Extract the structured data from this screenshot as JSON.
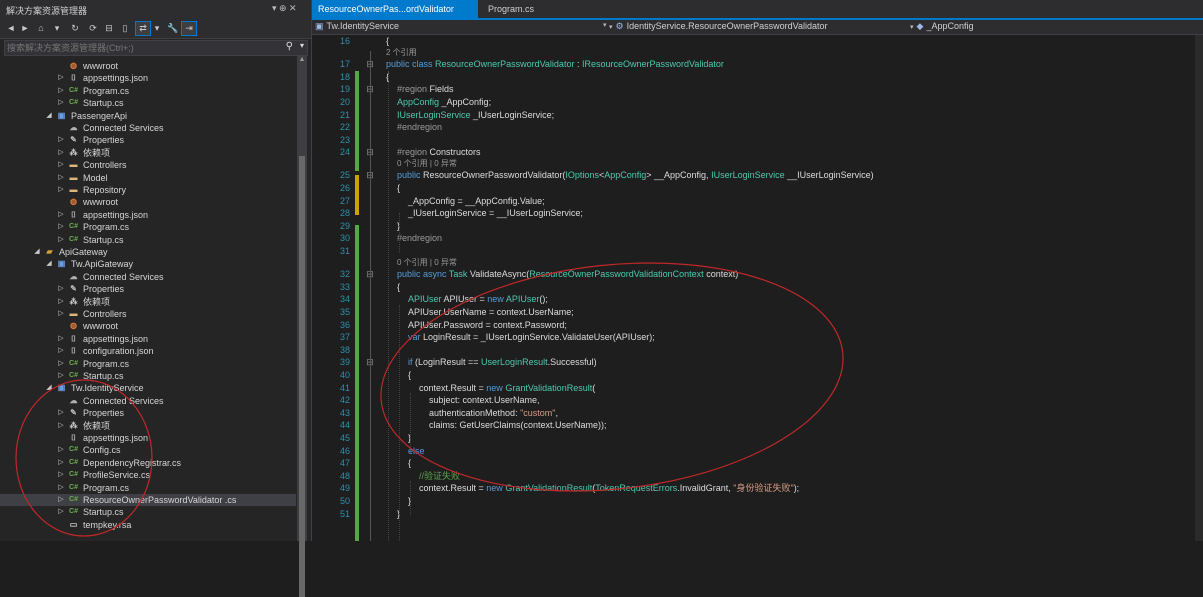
{
  "solution_explorer": {
    "title": "解决方案资源管理器",
    "pin": "▾ ⊕ ✕",
    "search_placeholder": "搜索解决方案资源管理器(Ctrl+;)",
    "items": [
      {
        "label": "wwwroot",
        "icon": "www",
        "level": 3,
        "exp": ""
      },
      {
        "label": "appsettings.json",
        "icon": "json",
        "level": 3,
        "exp": "▷"
      },
      {
        "label": "Program.cs",
        "icon": "cs",
        "level": 3,
        "exp": "▷"
      },
      {
        "label": "Startup.cs",
        "icon": "cs",
        "level": 3,
        "exp": "▷"
      },
      {
        "label": "PassengerApi",
        "icon": "proj",
        "level": 2,
        "exp": "◢"
      },
      {
        "label": "Connected Services",
        "icon": "cloud",
        "level": 3,
        "exp": ""
      },
      {
        "label": "Properties",
        "icon": "wrench",
        "level": 3,
        "exp": "▷"
      },
      {
        "label": "依赖项",
        "icon": "deps",
        "level": 3,
        "exp": "▷"
      },
      {
        "label": "Controllers",
        "icon": "folder",
        "level": 3,
        "exp": "▷"
      },
      {
        "label": "Model",
        "icon": "folder",
        "level": 3,
        "exp": "▷"
      },
      {
        "label": "Repository",
        "icon": "folder",
        "level": 3,
        "exp": "▷"
      },
      {
        "label": "wwwroot",
        "icon": "www",
        "level": 3,
        "exp": ""
      },
      {
        "label": "appsettings.json",
        "icon": "json",
        "level": 3,
        "exp": "▷"
      },
      {
        "label": "Program.cs",
        "icon": "cs",
        "level": 3,
        "exp": "▷"
      },
      {
        "label": "Startup.cs",
        "icon": "cs",
        "level": 3,
        "exp": "▷"
      },
      {
        "label": "ApiGateway",
        "icon": "sln",
        "level": 1,
        "exp": "◢"
      },
      {
        "label": "Tw.ApiGateway",
        "icon": "proj",
        "level": 2,
        "exp": "◢"
      },
      {
        "label": "Connected Services",
        "icon": "cloud",
        "level": 3,
        "exp": ""
      },
      {
        "label": "Properties",
        "icon": "wrench",
        "level": 3,
        "exp": "▷"
      },
      {
        "label": "依赖项",
        "icon": "deps",
        "level": 3,
        "exp": "▷"
      },
      {
        "label": "Controllers",
        "icon": "folder",
        "level": 3,
        "exp": "▷"
      },
      {
        "label": "wwwroot",
        "icon": "www",
        "level": 3,
        "exp": ""
      },
      {
        "label": "appsettings.json",
        "icon": "json",
        "level": 3,
        "exp": "▷"
      },
      {
        "label": "configuration.json",
        "icon": "json",
        "level": 3,
        "exp": "▷"
      },
      {
        "label": "Program.cs",
        "icon": "cs",
        "level": 3,
        "exp": "▷"
      },
      {
        "label": "Startup.cs",
        "icon": "cs",
        "level": 3,
        "exp": "▷"
      },
      {
        "label": "Tw.IdentityService",
        "icon": "proj",
        "level": 2,
        "exp": "◢"
      },
      {
        "label": "Connected Services",
        "icon": "cloud",
        "level": 3,
        "exp": ""
      },
      {
        "label": "Properties",
        "icon": "wrench",
        "level": 3,
        "exp": "▷"
      },
      {
        "label": "依赖项",
        "icon": "deps",
        "level": 3,
        "exp": "▷"
      },
      {
        "label": "appsettings.json",
        "icon": "json",
        "level": 3,
        "exp": ""
      },
      {
        "label": "Config.cs",
        "icon": "cs",
        "level": 3,
        "exp": "▷"
      },
      {
        "label": "DependencyRegistrar.cs",
        "icon": "cs",
        "level": 3,
        "exp": "▷"
      },
      {
        "label": "ProfileService.cs",
        "icon": "cs",
        "level": 3,
        "exp": "▷"
      },
      {
        "label": "Program.cs",
        "icon": "cs",
        "level": 3,
        "exp": "▷"
      },
      {
        "label": "ResourceOwnerPasswordValidator .cs",
        "icon": "cs",
        "level": 3,
        "exp": "▷",
        "selected": true
      },
      {
        "label": "Startup.cs",
        "icon": "cs",
        "level": 3,
        "exp": "▷"
      },
      {
        "label": "tempkey.rsa",
        "icon": "file",
        "level": 3,
        "exp": ""
      }
    ]
  },
  "editor": {
    "tabs": [
      {
        "label": "ResourceOwnerPas...ordValidator .cs",
        "active": true,
        "pin": "⊕",
        "close": "✕"
      },
      {
        "label": "Program.cs",
        "active": false
      }
    ],
    "nav": {
      "project": "Tw.IdentityService",
      "class": "IdentityService.ResourceOwnerPasswordValidator",
      "member": "_AppConfig"
    },
    "codelens": {
      "refs2": "2 个引用",
      "refs0": "0 个引用 | 0 异常"
    },
    "lines": [
      {
        "n": "16",
        "fold": "",
        "indent": 0,
        "html": "{"
      },
      {
        "n": "17",
        "fold": "⊟",
        "indent": 0,
        "lens": "2 个引用",
        "html": "<span class='kw'>public class</span> <span class='ty'>ResourceOwnerPasswordValidator</span> : <span class='ty'>IResourceOwnerPasswordValidator</span>"
      },
      {
        "n": "18",
        "fold": "",
        "indent": 0,
        "html": "{"
      },
      {
        "n": "19",
        "fold": "⊟",
        "indent": 1,
        "html": "<span class='pp'>#region</span> Fields"
      },
      {
        "n": "20",
        "fold": "",
        "indent": 1,
        "html": "<span class='ty'>AppConfig</span> _AppConfig;"
      },
      {
        "n": "21",
        "fold": "",
        "indent": 1,
        "html": "<span class='ty'>IUserLoginService</span> _IUserLoginService;"
      },
      {
        "n": "22",
        "fold": "",
        "indent": 1,
        "html": "<span class='pp'>#endregion</span>"
      },
      {
        "n": "23",
        "fold": "",
        "indent": 1,
        "html": ""
      },
      {
        "n": "24",
        "fold": "⊟",
        "indent": 1,
        "html": "<span class='pp'>#region</span> Constructors"
      },
      {
        "n": "25",
        "fold": "⊟",
        "indent": 1,
        "lens": "0 个引用 | 0 异常",
        "html": "<span class='kw'>public</span> ResourceOwnerPasswordValidator(<span class='ty'>IOptions</span>&lt;<span class='ty'>AppConfig</span>&gt; __AppConfig, <span class='ty'>IUserLoginService</span> __IUserLoginService)"
      },
      {
        "n": "26",
        "fold": "",
        "indent": 1,
        "html": "{"
      },
      {
        "n": "27",
        "fold": "",
        "indent": 2,
        "html": "_AppConfig = __AppConfig.Value;"
      },
      {
        "n": "28",
        "fold": "",
        "indent": 2,
        "html": "_IUserLoginService = __IUserLoginService;"
      },
      {
        "n": "29",
        "fold": "",
        "indent": 1,
        "html": "}"
      },
      {
        "n": "30",
        "fold": "",
        "indent": 1,
        "html": "<span class='pp'>#endregion</span>"
      },
      {
        "n": "31",
        "fold": "",
        "indent": 1,
        "html": ""
      },
      {
        "n": "32",
        "fold": "⊟",
        "indent": 1,
        "lens": "0 个引用 | 0 异常",
        "html": "<span class='kw'>public async</span> <span class='ty'>Task</span> ValidateAsync(<span class='ty'>ResourceOwnerPasswordValidationContext</span> context)"
      },
      {
        "n": "33",
        "fold": "",
        "indent": 1,
        "html": "{"
      },
      {
        "n": "34",
        "fold": "",
        "indent": 2,
        "html": "<span class='ty'>APIUser</span> APIUser = <span class='kw'>new</span> <span class='ty'>APIUser</span>();"
      },
      {
        "n": "35",
        "fold": "",
        "indent": 2,
        "html": "APIUser.UserName = context.UserName;"
      },
      {
        "n": "36",
        "fold": "",
        "indent": 2,
        "html": "APIUser.Password = context.Password;"
      },
      {
        "n": "37",
        "fold": "",
        "indent": 2,
        "html": "<span class='kw'>var</span> LoginResult = _IUserLoginService.ValidateUser(APIUser);"
      },
      {
        "n": "38",
        "fold": "",
        "indent": 2,
        "html": ""
      },
      {
        "n": "39",
        "fold": "⊟",
        "indent": 2,
        "html": "<span class='kw'>if</span> (LoginResult == <span class='ty'>UserLoginResult</span>.Successful)"
      },
      {
        "n": "40",
        "fold": "",
        "indent": 2,
        "html": "{"
      },
      {
        "n": "41",
        "fold": "",
        "indent": 3,
        "html": "context.Result = <span class='kw'>new</span> <span class='ty'>GrantValidationResult</span>("
      },
      {
        "n": "42",
        "fold": "",
        "indent": 3,
        "html": "    subject: context.UserName,"
      },
      {
        "n": "43",
        "fold": "",
        "indent": 3,
        "html": "    authenticationMethod: <span class='st'>\"custom\"</span>,"
      },
      {
        "n": "44",
        "fold": "",
        "indent": 3,
        "html": "    claims: GetUserClaims(context.UserName));"
      },
      {
        "n": "45",
        "fold": "",
        "indent": 2,
        "html": "}"
      },
      {
        "n": "46",
        "fold": "",
        "indent": 2,
        "html": "<span class='kw'>else</span>"
      },
      {
        "n": "47",
        "fold": "",
        "indent": 2,
        "html": "{"
      },
      {
        "n": "48",
        "fold": "",
        "indent": 3,
        "html": "<span class='cm'>//验证失败</span>"
      },
      {
        "n": "49",
        "fold": "",
        "indent": 3,
        "html": "context.Result = <span class='kw'>new</span> <span class='ty'>GrantValidationResult</span>(<span class='ty'>TokenRequestErrors</span>.InvalidGrant, <span class='st'>\"身份验证失败\"</span>);"
      },
      {
        "n": "50",
        "fold": "",
        "indent": 2,
        "html": "}"
      },
      {
        "n": "51",
        "fold": "",
        "indent": 1,
        "html": "}"
      }
    ]
  }
}
